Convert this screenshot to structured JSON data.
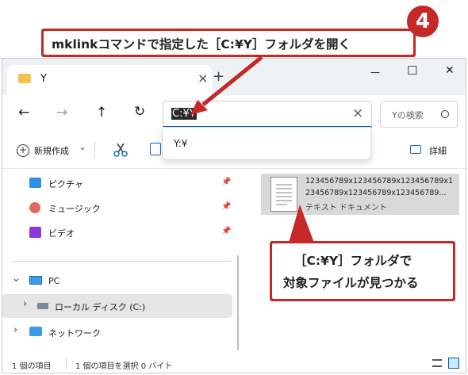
{
  "tab": {
    "title": "Y",
    "close": "×",
    "new_tab": "+"
  },
  "window_controls": {
    "minimize": "—",
    "maximize": "☐",
    "close": "✕"
  },
  "nav": {
    "back": "←",
    "forward": "→",
    "up": "↑",
    "refresh": "↻"
  },
  "address": {
    "value": "C:¥Y",
    "clear": "×",
    "suggestion": "Y:¥"
  },
  "search": {
    "placeholder": "Yの検索"
  },
  "cmdbar": {
    "new_label": "新規作成",
    "new_chevron": "⌄",
    "details_label": "詳細"
  },
  "sidebar": {
    "quick": [
      {
        "label": "ピクチャ",
        "pin": "📌"
      },
      {
        "label": "ミュージック",
        "pin": "📌"
      },
      {
        "label": "ビデオ",
        "pin": "📌"
      }
    ],
    "pc_label": "PC",
    "local_disk_label": "ローカル ディスク (C:)",
    "network_label": "ネットワーク",
    "expand_open": "⌄",
    "expand_closed": "›"
  },
  "file": {
    "name_line1": "123456789x123456789x123456789x1",
    "name_line2": "23456789x123456789x123456789...",
    "type": "テキスト ドキュメント"
  },
  "status": {
    "count": "1 個の項目",
    "selected": "1 個の項目を選択 0 バイト"
  },
  "annotations": {
    "step_number": "4",
    "top_callout": "mklinkコマンドで指定した［C:¥Y］フォルダを開く",
    "result_line1": "［C:¥Y］フォルダで",
    "result_line2": "対象ファイルが見つかる"
  },
  "colors": {
    "callout": "#c62828",
    "accent": "#005fb8",
    "selection": "#cce8ff"
  }
}
